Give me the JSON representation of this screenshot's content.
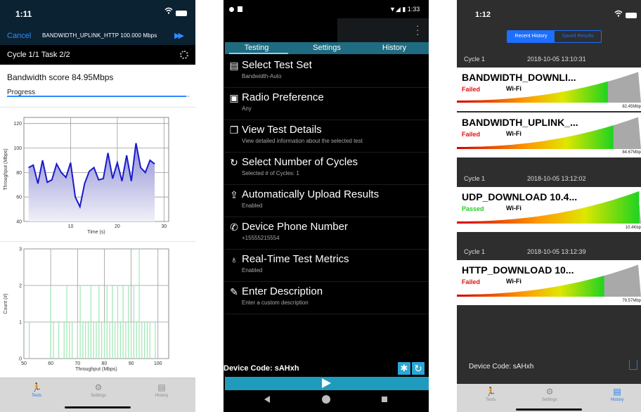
{
  "phone1": {
    "status_time": "1:11",
    "nav": {
      "cancel_label": "Cancel",
      "title": "BANDWIDTH_UPLINK_HTTP 100.000 Mbps"
    },
    "task_label": "Cycle 1/1 Task 2/2",
    "score_text": "Bandwidth score 84.95Mbps",
    "progress_label": "Progress",
    "progress_fraction": 0.98,
    "tabs": [
      {
        "label": "Tests",
        "icon": "runner-icon",
        "active": true
      },
      {
        "label": "Settings",
        "icon": "gear-icon",
        "active": false
      },
      {
        "label": "History",
        "icon": "history-icon",
        "active": false
      }
    ]
  },
  "chart_data": [
    {
      "type": "area",
      "xlabel": "Time (s)",
      "ylabel": "Throughput (Mbps)",
      "xlim": [
        0,
        31
      ],
      "ylim": [
        40,
        125
      ],
      "xticks": [
        10,
        20,
        30
      ],
      "yticks": [
        40,
        60,
        80,
        100,
        120
      ],
      "grid": true,
      "color": "#1a1acc",
      "series": [
        {
          "x": [
            1,
            2,
            3,
            4,
            5,
            6,
            7,
            8,
            9,
            10,
            11,
            12,
            13,
            14,
            15,
            16,
            17,
            18,
            19,
            20,
            21,
            22,
            23,
            24,
            25,
            26,
            27,
            28
          ],
          "values": [
            84,
            86,
            71,
            90,
            72,
            74,
            87,
            80,
            76,
            88,
            60,
            52,
            71,
            81,
            84,
            74,
            75,
            96,
            75,
            88,
            73,
            94,
            73,
            104,
            84,
            80,
            90,
            87
          ]
        }
      ]
    },
    {
      "type": "bar",
      "xlabel": "Throughput (Mbps)",
      "ylabel": "Count (#)",
      "xlim": [
        50,
        104
      ],
      "ylim": [
        0,
        3
      ],
      "xticks": [
        50,
        60,
        70,
        80,
        90,
        100
      ],
      "yticks": [
        0,
        1,
        2,
        3
      ],
      "grid": true,
      "color": "#9ee7b2",
      "x": [
        52,
        60,
        61,
        63,
        65,
        66,
        67,
        68,
        70,
        71,
        72,
        73,
        74,
        75,
        76,
        77,
        78,
        79,
        80,
        81,
        82,
        83,
        84,
        85,
        86,
        87,
        88,
        89,
        90,
        91,
        92,
        93,
        94,
        95,
        96,
        97,
        99
      ],
      "values": [
        1,
        2,
        1,
        1,
        1,
        2,
        1,
        1,
        1,
        2,
        1,
        1,
        1,
        2,
        1,
        1,
        2,
        1,
        1,
        2,
        1,
        2,
        1,
        2,
        1,
        2,
        1,
        2,
        1,
        2,
        1,
        3,
        1,
        1,
        1,
        1,
        1
      ]
    }
  ],
  "phone2": {
    "status_time": "1:33",
    "tabs": [
      "Testing",
      "Settings",
      "History"
    ],
    "items": [
      {
        "title": "Select Test Set",
        "subtitle": "Bandwidth-Auto",
        "icon": "test-set-icon"
      },
      {
        "title": "Radio Preference",
        "subtitle": "Any",
        "icon": "radio-icon"
      },
      {
        "title": "View Test Details",
        "subtitle": "View detailed information about the selected test",
        "icon": "details-icon"
      },
      {
        "title": "Select Number of Cycles",
        "subtitle": "Selected # of Cycles: 1",
        "icon": "cycle-icon"
      },
      {
        "title": "Automatically Upload Results",
        "subtitle": "Enabled",
        "icon": "upload-icon"
      },
      {
        "title": "Device Phone Number",
        "subtitle": "+15555215554",
        "icon": "phone-icon"
      },
      {
        "title": "Real-Time Test Metrics",
        "subtitle": "Enabled",
        "icon": "lightbulb-icon"
      },
      {
        "title": "Enter Description",
        "subtitle": "Enter a custom description",
        "icon": "edit-icon"
      }
    ],
    "device_code": "Device Code: sAHxh"
  },
  "phone3": {
    "status_time": "1:12",
    "segments": [
      "Recent History",
      "Saved Results"
    ],
    "cycles": [
      {
        "label": "Cycle 1",
        "date": "2018-10-05 13:10:31"
      },
      {
        "label": "Cycle 1",
        "date": "2018-10-05 13:12:02"
      },
      {
        "label": "Cycle 1",
        "date": "2018-10-05 13:12:39"
      }
    ],
    "results": [
      {
        "name": "BANDWIDTH_DOWNLI...",
        "status": "Failed",
        "status_color": "#e01010",
        "network": "Wi-Fi",
        "value": "82.45Mbp",
        "level": 0.82
      },
      {
        "name": "BANDWIDTH_UPLINK_...",
        "status": "Failed",
        "status_color": "#e01010",
        "network": "Wi-Fi",
        "value": "84.67Mbp",
        "level": 0.85
      },
      {
        "name": "UDP_DOWNLOAD 10.4...",
        "status": "Passed",
        "status_color": "#22cc22",
        "network": "Wi-Fi",
        "value": "10.4Kbp",
        "level": 0.99
      },
      {
        "name": "HTTP_DOWNLOAD 10...",
        "status": "Failed",
        "status_color": "#e01010",
        "network": "Wi-Fi",
        "value": "79.57Mbp",
        "level": 0.8
      }
    ],
    "device_code": "Device Code: sAHxh",
    "tabs": [
      {
        "label": "Tests",
        "icon": "runner-icon",
        "active": false
      },
      {
        "label": "Settings",
        "icon": "gear-icon",
        "active": false
      },
      {
        "label": "History",
        "icon": "history-icon",
        "active": true
      }
    ]
  }
}
